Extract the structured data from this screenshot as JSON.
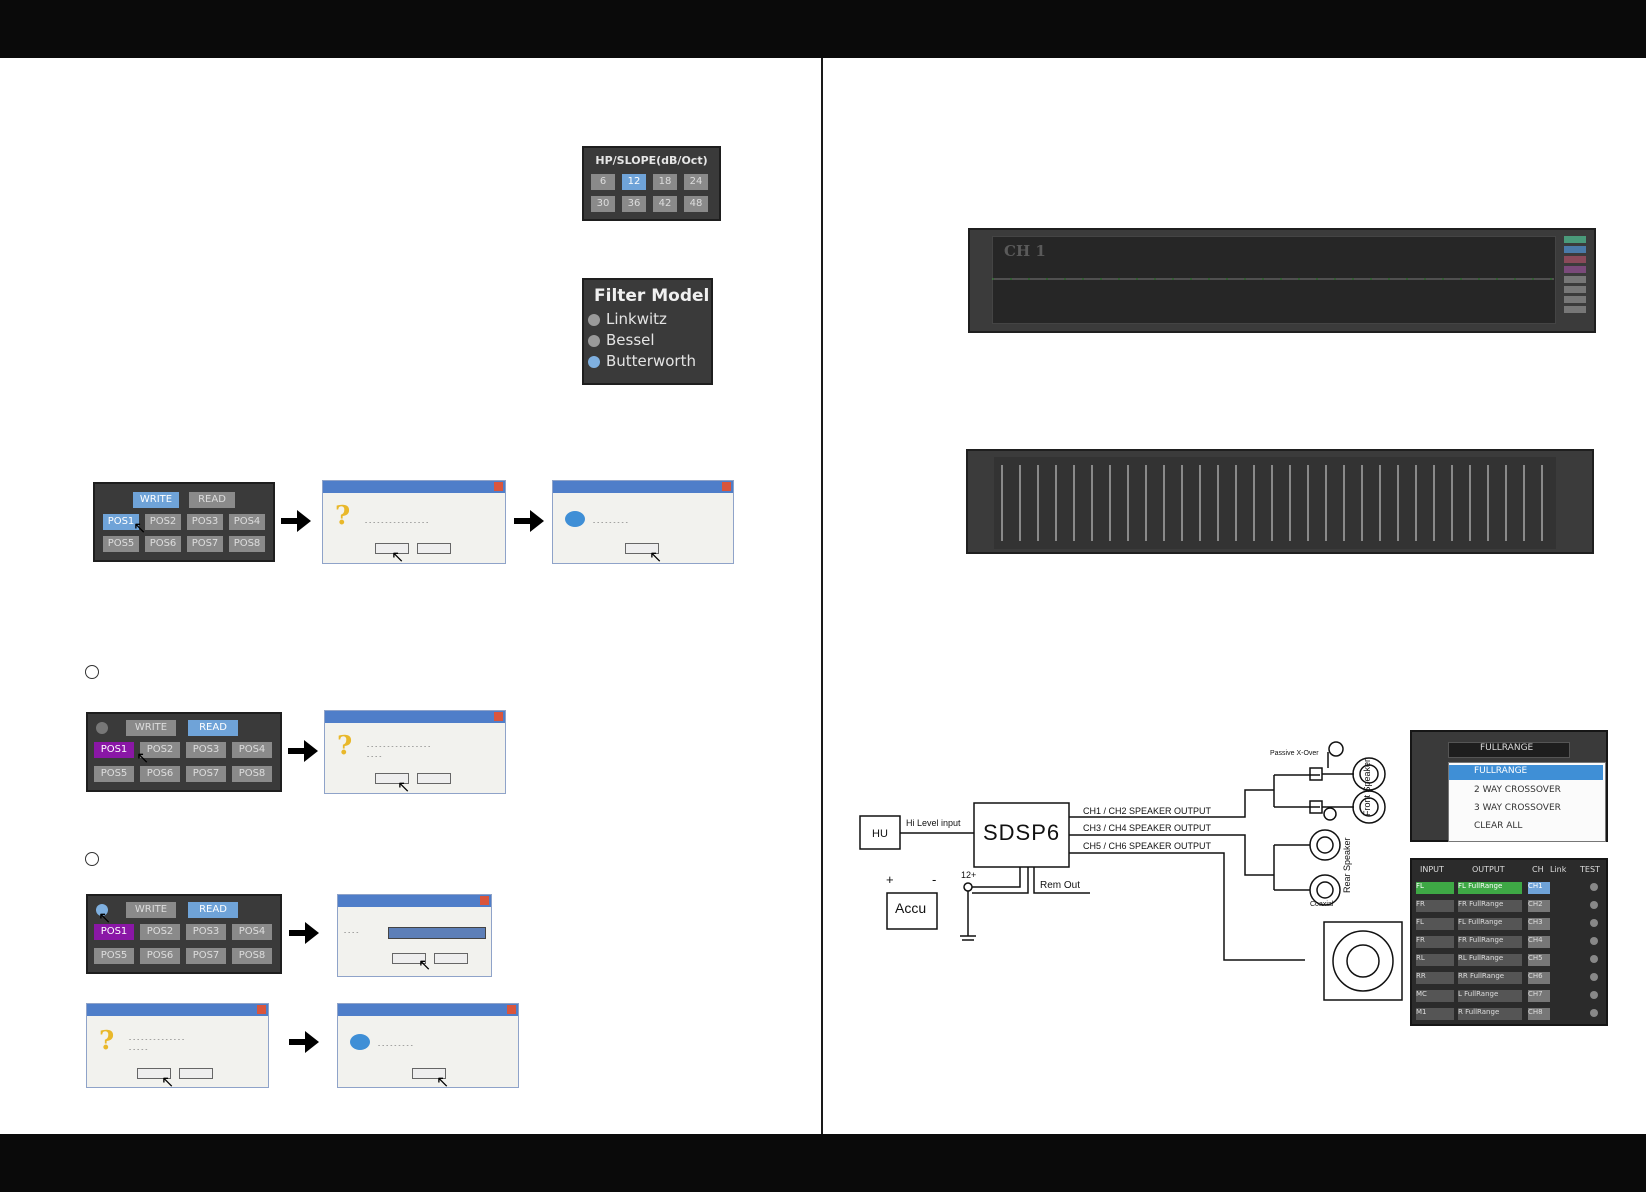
{
  "slope_panel": {
    "title": "HP/SLOPE(dB/Oct)",
    "row1": [
      "6",
      "12",
      "18",
      "24"
    ],
    "row2": [
      "30",
      "36",
      "42",
      "48"
    ]
  },
  "filter_panel": {
    "title": "Filter Model",
    "options": [
      "Linkwitz",
      "Bessel",
      "Butterworth"
    ]
  },
  "preset_panel": {
    "write_label": "WRITE",
    "read_label": "READ",
    "positions": [
      "POS1",
      "POS2",
      "POS3",
      "POS4",
      "POS5",
      "POS6",
      "POS7",
      "POS8"
    ]
  },
  "eq_graph": {
    "channel_label": "CH 1"
  },
  "wiring": {
    "hu": "HU",
    "hi_level_input": "Hi Level input",
    "sdsp": "SDSP6",
    "ch12": "CH1 / CH2 SPEAKER OUTPUT",
    "ch34": "CH3 / CH4 SPEAKER OUTPUT",
    "ch56": "CH5 / CH6 SPEAKER OUTPUT",
    "passive_xover": "Passive X-Over",
    "front_speaker": "Front Speaker",
    "rear_speaker": "Rear Speaker",
    "coaxial": "Coaxial",
    "plus": "+",
    "minus": "-",
    "twelve": "12+",
    "rem_out": "Rem Out",
    "accu": "Accu"
  },
  "crossover_menu": {
    "selected": "FULLRANGE",
    "options": [
      "FULLRANGE",
      "2 WAY CROSSOVER",
      "3 WAY CROSSOVER",
      "CLEAR ALL"
    ]
  },
  "routing": {
    "headers": [
      "INPUT",
      "OUTPUT",
      "CH",
      "Link",
      "TEST"
    ],
    "rows": [
      {
        "input": "FL",
        "output": "FL FullRange",
        "ch": "CH1"
      },
      {
        "input": "FR",
        "output": "FR FullRange",
        "ch": "CH2"
      },
      {
        "input": "FL",
        "output": "FL FullRange",
        "ch": "CH3"
      },
      {
        "input": "FR",
        "output": "FR FullRange",
        "ch": "CH4"
      },
      {
        "input": "RL",
        "output": "RL FullRange",
        "ch": "CH5"
      },
      {
        "input": "RR",
        "output": "RR FullRange",
        "ch": "CH6"
      },
      {
        "input": "MC",
        "output": "L FullRange",
        "ch": "CH7"
      },
      {
        "input": "M1",
        "output": "R FullRange",
        "ch": "CH8"
      }
    ]
  }
}
